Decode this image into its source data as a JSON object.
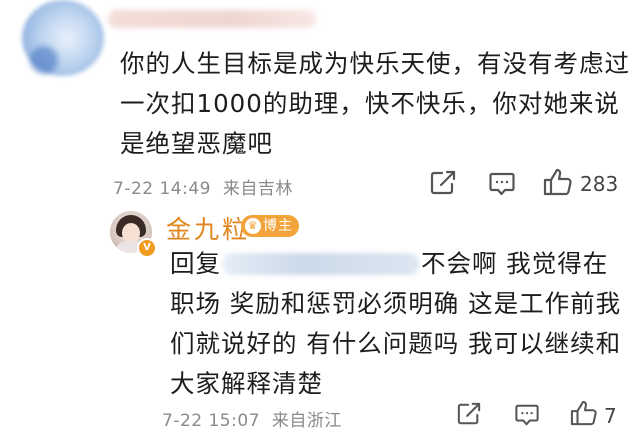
{
  "comment": {
    "text": "你的人生目标是成为快乐天使，有没有考虑过一次扣1000的助理，快不快乐，你对她来说是绝望恶魔吧",
    "date": "7-22 14:49",
    "location": "来自吉林",
    "like_count": "283",
    "icons": [
      "share-icon",
      "comment-icon",
      "like-icon"
    ]
  },
  "reply": {
    "author_name": "金九粒",
    "badge_label": "博主",
    "prefix": "回复",
    "text": "不会啊 我觉得在职场 奖励和惩罚必须明确 这是工作前我们就说好的 有什么问题吗 我可以继续和大家解释清楚",
    "date": "7-22 15:07",
    "location": "来自浙江",
    "like_count": "7",
    "icons": [
      "share-icon",
      "comment-icon",
      "like-icon"
    ]
  },
  "colors": {
    "author_name": "#e0861e",
    "badge": "#f2a43a",
    "meta_text": "#8a8a8a"
  }
}
